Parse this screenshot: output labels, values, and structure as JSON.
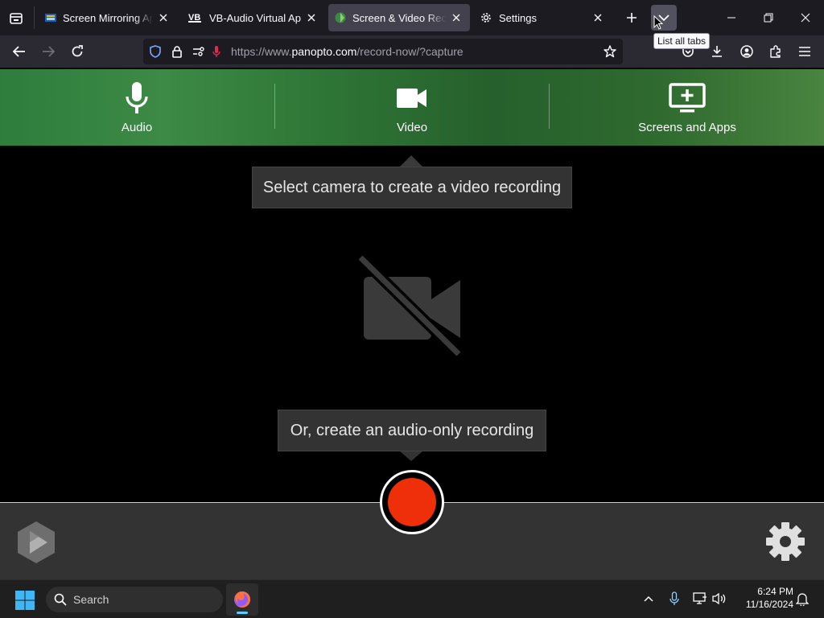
{
  "browser": {
    "tabs": [
      {
        "title": "Screen Mirroring App ·",
        "active": false
      },
      {
        "title": "VB-Audio Virtual Apps",
        "active": false
      },
      {
        "title": "Screen & Video Record",
        "active": true
      },
      {
        "title": "Settings",
        "active": false
      }
    ],
    "tooltip": "List all tabs",
    "address": {
      "prefix": "https://www.",
      "host": "panopto.com",
      "path": "/record-now/?capture"
    }
  },
  "recorder": {
    "sources": [
      {
        "label": "Audio",
        "icon": "microphone-icon"
      },
      {
        "label": "Video",
        "icon": "video-camera-icon"
      },
      {
        "label": "Screens and Apps",
        "icon": "add-screen-icon"
      }
    ],
    "video_hint": "Select camera to create a video recording",
    "audio_hint": "Or, create an audio-only recording",
    "colors": {
      "header_green": "#2e7535",
      "record_red": "#ef2e0a",
      "control_bar": "#333333"
    }
  },
  "taskbar": {
    "search_label": "Search",
    "time": "6:24 PM",
    "date": "11/16/2024"
  }
}
